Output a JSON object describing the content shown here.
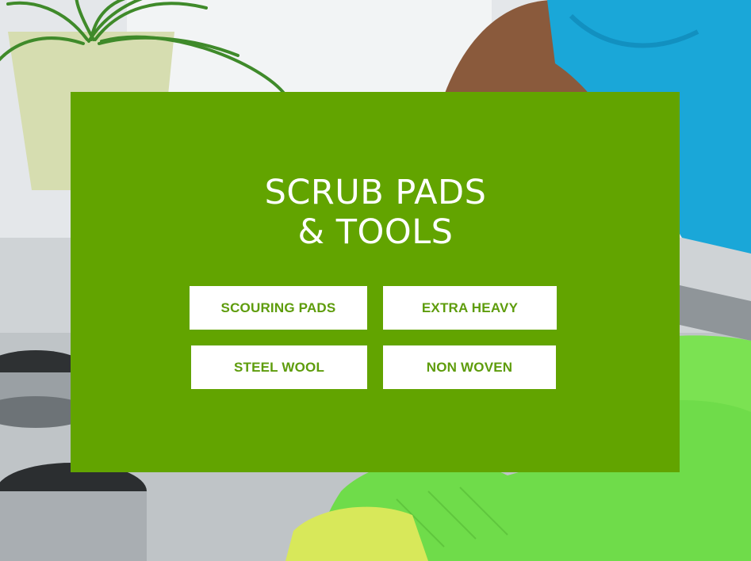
{
  "section": {
    "title_line1": "SCRUB PADS",
    "title_line2": "& TOOLS"
  },
  "categories": [
    {
      "label": "SCOURING PADS"
    },
    {
      "label": "EXTRA HEAVY"
    },
    {
      "label": "STEEL WOOL"
    },
    {
      "label": "NON WOVEN"
    }
  ],
  "colors": {
    "panel_green": "#62a400",
    "button_bg": "#ffffff",
    "button_text": "#5e9c0c"
  }
}
